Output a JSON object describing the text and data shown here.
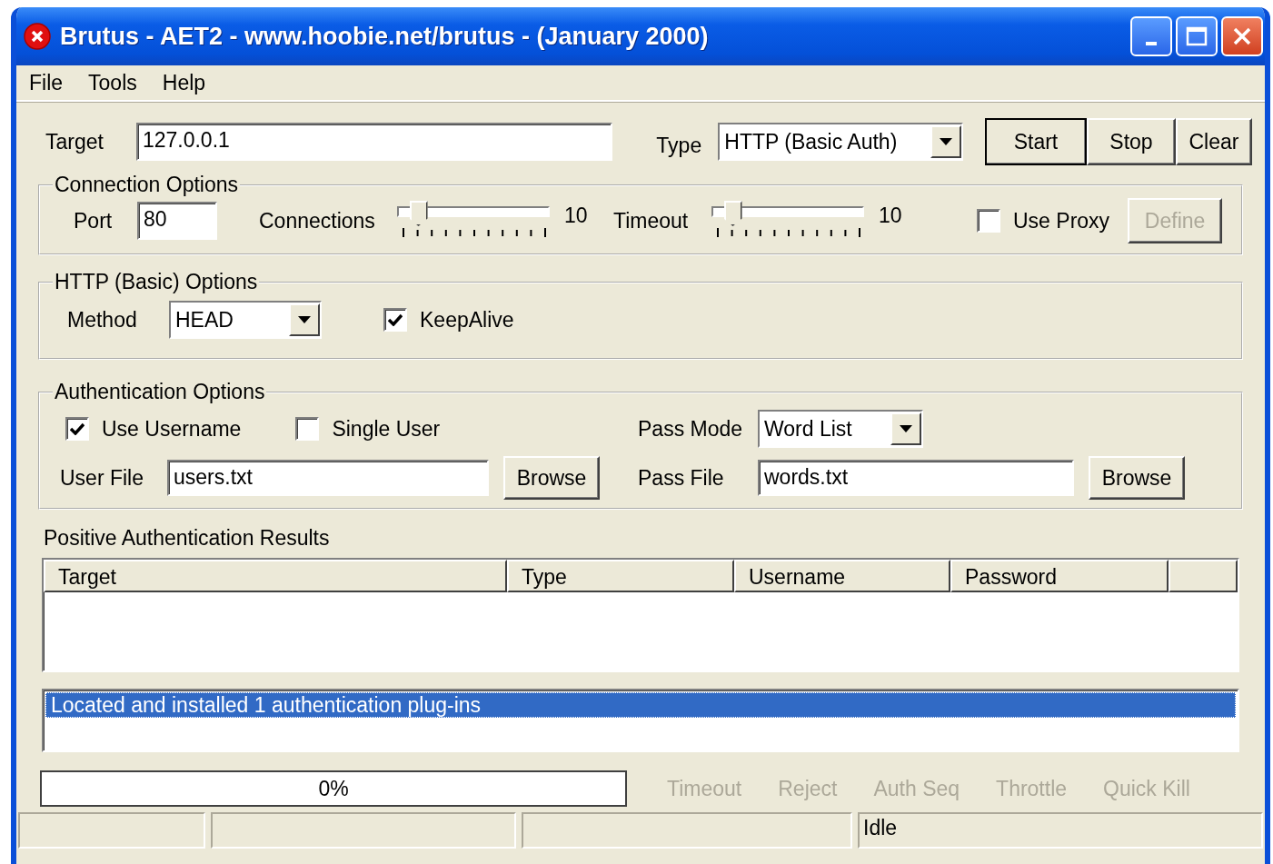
{
  "window": {
    "title": "Brutus - AET2 - www.hoobie.net/brutus - (January 2000)"
  },
  "menu": [
    "File",
    "Tools",
    "Help"
  ],
  "target": {
    "label": "Target",
    "value": "127.0.0.1"
  },
  "type": {
    "label": "Type",
    "value": "HTTP (Basic Auth)"
  },
  "actions": [
    {
      "label": "Start",
      "default": true
    },
    {
      "label": "Stop",
      "default": false
    },
    {
      "label": "Clear",
      "default": false
    }
  ],
  "connection_options": {
    "title": "Connection Options",
    "port": {
      "label": "Port",
      "value": "80"
    },
    "sliders": [
      {
        "label": "Connections",
        "level": 0.05,
        "reading": "10"
      },
      {
        "label": "Timeout",
        "level": 0.05,
        "reading": "10"
      }
    ],
    "use_proxy": {
      "label": "Use Proxy",
      "checked": false
    },
    "define": {
      "label": "Define",
      "disabled": true
    }
  },
  "http_options": {
    "title": "HTTP (Basic) Options",
    "method": {
      "label": "Method",
      "value": "HEAD"
    },
    "keepalive": {
      "label": "KeepAlive",
      "checked": true
    }
  },
  "auth_options": {
    "title": "Authentication Options",
    "use_username": {
      "label": "Use Username",
      "checked": true
    },
    "single_user": {
      "label": "Single User",
      "checked": false
    },
    "pass_mode": {
      "label": "Pass Mode",
      "value": "Word List"
    },
    "user_file": {
      "label": "User File",
      "value": "users.txt",
      "button": "Browse"
    },
    "pass_file": {
      "label": "Pass File",
      "value": "words.txt",
      "button": "Browse"
    }
  },
  "results": {
    "title": "Positive Authentication Results",
    "columns": [
      "Target",
      "Type",
      "Username",
      "Password"
    ]
  },
  "log": [
    {
      "text": "Located and installed 1 authentication plug-ins",
      "selected": true
    }
  ],
  "progress": {
    "level": 0,
    "text": "0%"
  },
  "indicators": [
    {
      "label": "Timeout",
      "disabled": true
    },
    {
      "label": "Reject",
      "disabled": true
    },
    {
      "label": "Auth Seq",
      "disabled": true
    },
    {
      "label": "Throttle",
      "disabled": true
    },
    {
      "label": "Quick Kill",
      "disabled": true
    }
  ],
  "status_bar": {
    "text": "Idle"
  }
}
